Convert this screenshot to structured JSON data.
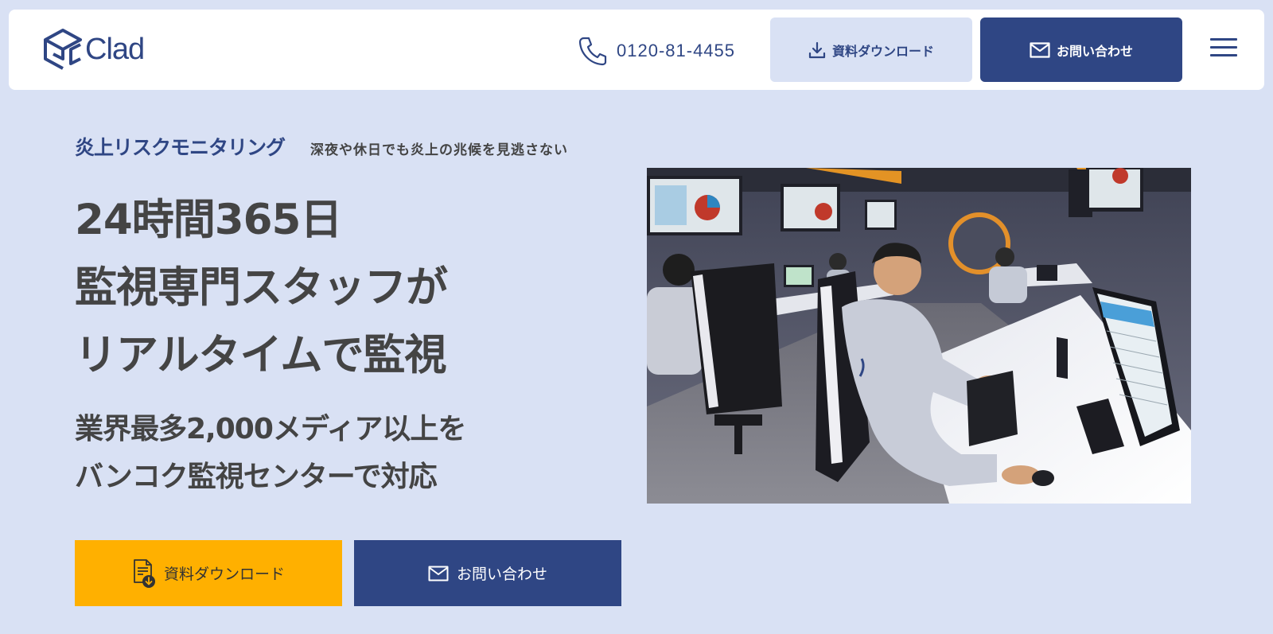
{
  "header": {
    "logo_text": "Clad",
    "phone_number": "0120-81-4455",
    "download_label": "資料ダウンロード",
    "contact_label": "お問い合わせ"
  },
  "hero": {
    "eyebrow_title": "炎上リスクモニタリング",
    "eyebrow_subtitle": "深夜や休日でも炎上の兆候を見逃さない",
    "headline": [
      "24時間365日",
      "監視専門スタッフが",
      "リアルタイムで監視"
    ],
    "subline": [
      "業界最多2,000メディア以上を",
      "バンコク監視センターで対応"
    ],
    "cta_download": "資料ダウンロード",
    "cta_contact": "お問い合わせ"
  },
  "colors": {
    "page_bg": "#d9e1f4",
    "brand_navy": "#2f4684",
    "accent_yellow": "#ffb000",
    "text_dark": "#444444"
  },
  "icons": {
    "logo": "box-logo-icon",
    "phone": "phone-icon",
    "download": "download-icon",
    "mail": "mail-icon",
    "menu": "hamburger-menu-icon",
    "document": "document-download-icon"
  }
}
